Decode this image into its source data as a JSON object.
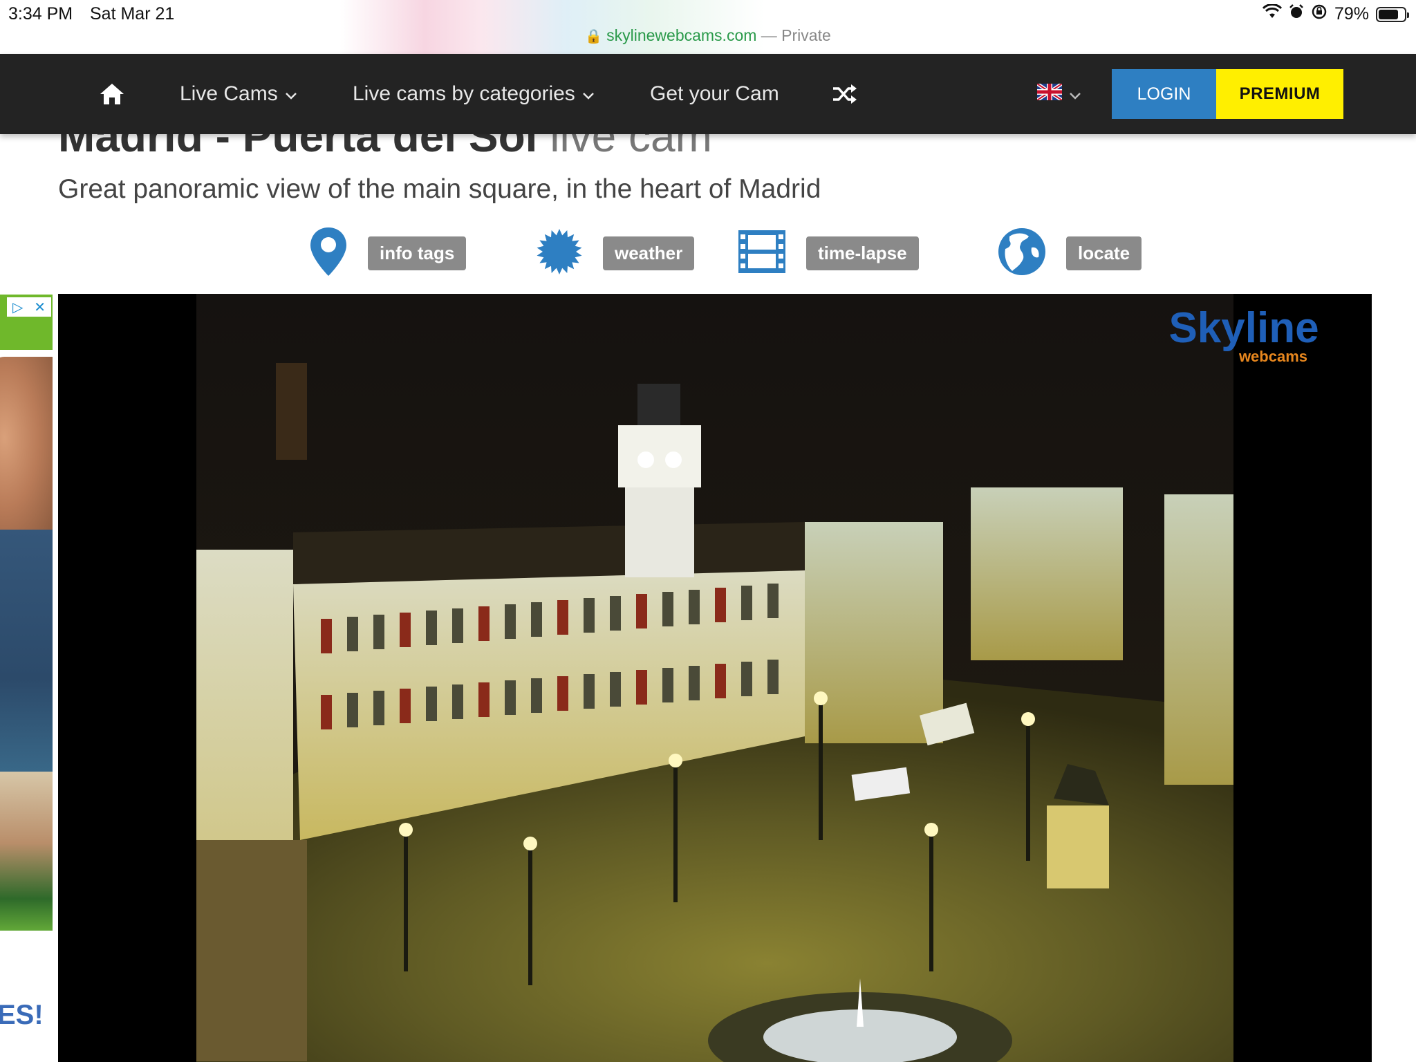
{
  "status_bar": {
    "time": "3:34 PM",
    "date": "Sat Mar 21",
    "battery_text": "79%",
    "battery_level": 0.79,
    "url_domain": "skylinewebcams.com",
    "url_suffix": "— Private"
  },
  "nav": {
    "live_cams": "Live Cams",
    "categories": "Live cams by categories",
    "get_cam": "Get your Cam",
    "login": "LOGIN",
    "premium": "PREMIUM"
  },
  "page": {
    "title_bold": "Madrid - Puerta del Sol",
    "title_light": "live cam",
    "subtitle": "Great panoramic view of the main square, in the heart of Madrid"
  },
  "actions": [
    {
      "label": "info tags",
      "icon": "map-pin-icon"
    },
    {
      "label": "weather",
      "icon": "sun-icon"
    },
    {
      "label": "time-lapse",
      "icon": "film-icon"
    },
    {
      "label": "locate",
      "icon": "globe-icon"
    }
  ],
  "ad": {
    "text": "ES!"
  },
  "webcam": {
    "logo_main": "Skyline",
    "logo_sub": "webcams"
  },
  "colors": {
    "nav_bg": "#232323",
    "login_bg": "#2e7fc2",
    "premium_bg": "#ffef00",
    "icon_blue": "#2e7fc2",
    "pill_bg": "#8a8a8a",
    "url_green": "#2a9a4a"
  }
}
